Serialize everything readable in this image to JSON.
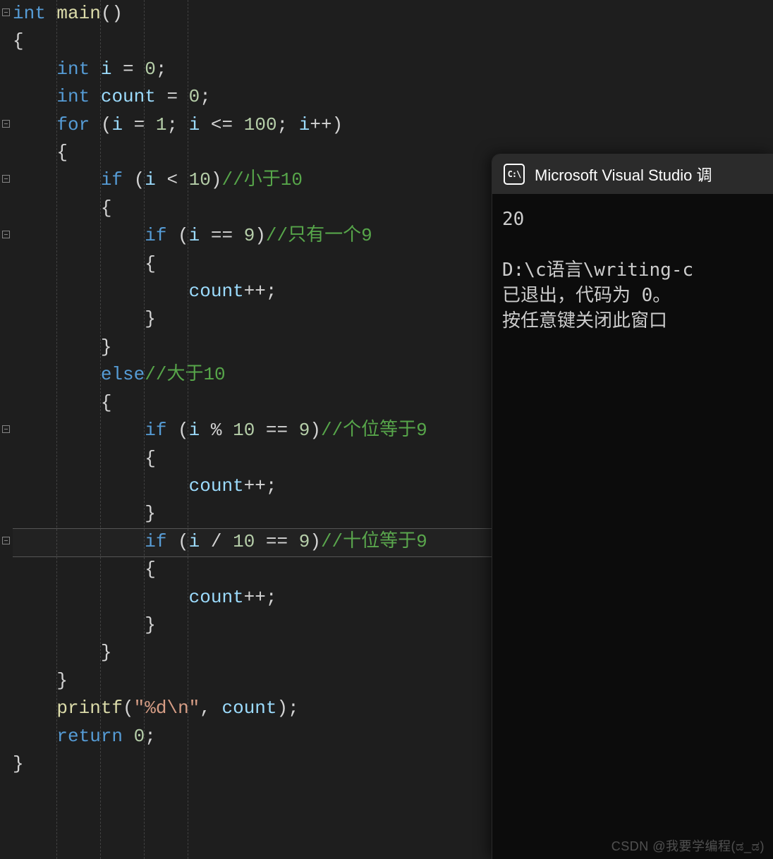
{
  "code": {
    "lines": [
      [
        [
          "kw",
          "int"
        ],
        [
          "op",
          " "
        ],
        [
          "fn",
          "main"
        ],
        [
          "pn",
          "()"
        ]
      ],
      [
        [
          "pn",
          "{"
        ]
      ],
      [
        [
          "op",
          "    "
        ],
        [
          "kw",
          "int"
        ],
        [
          "op",
          " "
        ],
        [
          "id",
          "i"
        ],
        [
          "op",
          " = "
        ],
        [
          "num",
          "0"
        ],
        [
          "op",
          ";"
        ]
      ],
      [
        [
          "op",
          "    "
        ],
        [
          "kw",
          "int"
        ],
        [
          "op",
          " "
        ],
        [
          "id",
          "count"
        ],
        [
          "op",
          " = "
        ],
        [
          "num",
          "0"
        ],
        [
          "op",
          ";"
        ]
      ],
      [
        [
          "op",
          "    "
        ],
        [
          "kw",
          "for"
        ],
        [
          "op",
          " ("
        ],
        [
          "id",
          "i"
        ],
        [
          "op",
          " = "
        ],
        [
          "num",
          "1"
        ],
        [
          "op",
          "; "
        ],
        [
          "id",
          "i"
        ],
        [
          "op",
          " <= "
        ],
        [
          "num",
          "100"
        ],
        [
          "op",
          "; "
        ],
        [
          "id",
          "i"
        ],
        [
          "op",
          "++)"
        ]
      ],
      [
        [
          "op",
          "    "
        ],
        [
          "pn",
          "{"
        ]
      ],
      [
        [
          "op",
          "        "
        ],
        [
          "kw",
          "if"
        ],
        [
          "op",
          " ("
        ],
        [
          "id",
          "i"
        ],
        [
          "op",
          " < "
        ],
        [
          "num",
          "10"
        ],
        [
          "op",
          ")"
        ],
        [
          "cmt",
          "//小于10"
        ]
      ],
      [
        [
          "op",
          "        "
        ],
        [
          "pn",
          "{"
        ]
      ],
      [
        [
          "op",
          "            "
        ],
        [
          "kw",
          "if"
        ],
        [
          "op",
          " ("
        ],
        [
          "id",
          "i"
        ],
        [
          "op",
          " == "
        ],
        [
          "num",
          "9"
        ],
        [
          "op",
          ")"
        ],
        [
          "cmt",
          "//只有一个9"
        ]
      ],
      [
        [
          "op",
          "            "
        ],
        [
          "pn",
          "{"
        ]
      ],
      [
        [
          "op",
          "                "
        ],
        [
          "id",
          "count"
        ],
        [
          "op",
          "++;"
        ]
      ],
      [
        [
          "op",
          "            "
        ],
        [
          "pn",
          "}"
        ]
      ],
      [
        [
          "op",
          "        "
        ],
        [
          "pn",
          "}"
        ]
      ],
      [
        [
          "op",
          "        "
        ],
        [
          "kw",
          "else"
        ],
        [
          "cmt",
          "//大于10"
        ]
      ],
      [
        [
          "op",
          "        "
        ],
        [
          "pn",
          "{"
        ]
      ],
      [
        [
          "op",
          "            "
        ],
        [
          "kw",
          "if"
        ],
        [
          "op",
          " ("
        ],
        [
          "id",
          "i"
        ],
        [
          "op",
          " % "
        ],
        [
          "num",
          "10"
        ],
        [
          "op",
          " == "
        ],
        [
          "num",
          "9"
        ],
        [
          "op",
          ")"
        ],
        [
          "cmt",
          "//个位等于9"
        ]
      ],
      [
        [
          "op",
          "            "
        ],
        [
          "pn",
          "{"
        ]
      ],
      [
        [
          "op",
          "                "
        ],
        [
          "id",
          "count"
        ],
        [
          "op",
          "++;"
        ]
      ],
      [
        [
          "op",
          "            "
        ],
        [
          "pn",
          "}"
        ]
      ],
      [
        [
          "op",
          "            "
        ],
        [
          "kw",
          "if"
        ],
        [
          "op",
          " ("
        ],
        [
          "id",
          "i"
        ],
        [
          "op",
          " / "
        ],
        [
          "num",
          "10"
        ],
        [
          "op",
          " == "
        ],
        [
          "num",
          "9"
        ],
        [
          "op",
          ")"
        ],
        [
          "cmt",
          "//十位等于9"
        ]
      ],
      [
        [
          "op",
          "            "
        ],
        [
          "pn",
          "{"
        ]
      ],
      [
        [
          "op",
          "                "
        ],
        [
          "id",
          "count"
        ],
        [
          "op",
          "++;"
        ]
      ],
      [
        [
          "op",
          "            "
        ],
        [
          "pn",
          "}"
        ]
      ],
      [
        [
          "op",
          "        "
        ],
        [
          "pn",
          "}"
        ]
      ],
      [
        [
          "op",
          "    "
        ],
        [
          "pn",
          "}"
        ]
      ],
      [
        [
          "op",
          "    "
        ],
        [
          "fn",
          "printf"
        ],
        [
          "op",
          "("
        ],
        [
          "str",
          "\"%d\\n\""
        ],
        [
          "op",
          ", "
        ],
        [
          "id",
          "count"
        ],
        [
          "op",
          ");"
        ]
      ],
      [
        [
          "op",
          "    "
        ],
        [
          "kw",
          "return"
        ],
        [
          "op",
          " "
        ],
        [
          "num",
          "0"
        ],
        [
          "op",
          ";"
        ]
      ],
      [
        [
          "pn",
          "}"
        ]
      ]
    ],
    "highlight_line_index": 19,
    "fold_marker_lines": [
      0,
      4,
      6,
      8,
      15,
      19
    ]
  },
  "console": {
    "title": "Microsoft Visual Studio 调",
    "icon_text": "C:\\",
    "output_value": "20",
    "lines": [
      "",
      "D:\\c语言\\writing-c",
      "已退出，代码为 0。",
      "按任意键关闭此窗口"
    ]
  },
  "watermark": "CSDN @我要学编程(ಡ_ಡ)"
}
